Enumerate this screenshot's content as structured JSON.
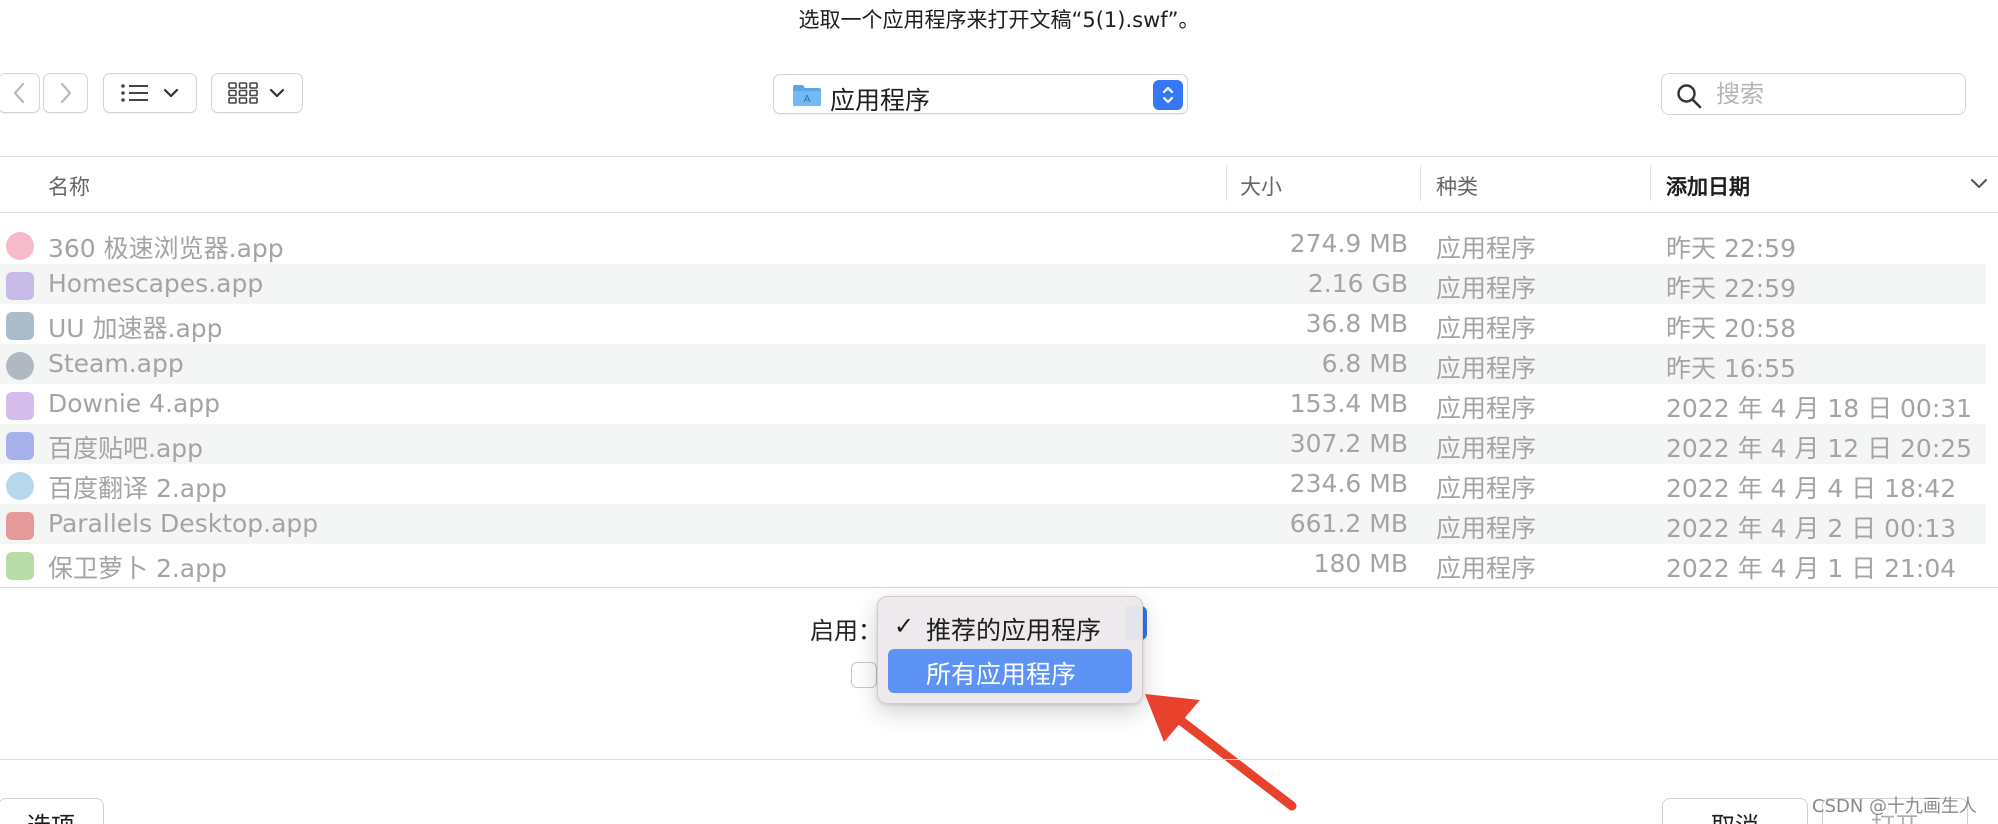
{
  "window_title": "选取一个应用程序来打开文稿“5(1).swf”。",
  "toolbar": {
    "back_icon": "chevron-left-icon",
    "forward_icon": "chevron-right-icon",
    "list_view_icon": "list-icon",
    "grid_view_icon": "grid-icon",
    "location": "应用程序",
    "search_placeholder": "搜索",
    "search_value": ""
  },
  "columns": {
    "name": "名称",
    "size": "大小",
    "kind": "种类",
    "date_added": "添加日期"
  },
  "files": [
    {
      "name": "360 极速浏览器.app",
      "size": "274.9 MB",
      "kind": "应用程序",
      "date": "昨天 22:59",
      "icon": "browser-360-icon",
      "color": "#f4a3b9"
    },
    {
      "name": "Homescapes.app",
      "size": "2.16 GB",
      "kind": "应用程序",
      "date": "昨天 22:59",
      "icon": "homescapes-icon",
      "color": "#b9a6e0"
    },
    {
      "name": "UU 加速器.app",
      "size": "36.8 MB",
      "kind": "应用程序",
      "date": "昨天 20:58",
      "icon": "uu-accelerator-icon",
      "color": "#8fa6b8"
    },
    {
      "name": "Steam.app",
      "size": "6.8 MB",
      "kind": "应用程序",
      "date": "昨天 16:55",
      "icon": "steam-icon",
      "color": "#9aa4b0"
    },
    {
      "name": "Downie 4.app",
      "size": "153.4 MB",
      "kind": "应用程序",
      "date": "2022 年 4 月 18 日 00:31",
      "icon": "downie-icon",
      "color": "#c6a6e6"
    },
    {
      "name": "百度贴吧.app",
      "size": "307.2 MB",
      "kind": "应用程序",
      "date": "2022 年 4 月 12 日 20:25",
      "icon": "baidu-tieba-icon",
      "color": "#8c9ae8"
    },
    {
      "name": "百度翻译 2.app",
      "size": "234.6 MB",
      "kind": "应用程序",
      "date": "2022 年 4 月 4 日 18:42",
      "icon": "baidu-translate-icon",
      "color": "#9ccbe8"
    },
    {
      "name": "Parallels Desktop.app",
      "size": "661.2 MB",
      "kind": "应用程序",
      "date": "2022 年 4 月 2 日 00:13",
      "icon": "parallels-icon",
      "color": "#e07a7a"
    },
    {
      "name": "保卫萝卜 2.app",
      "size": "180 MB",
      "kind": "应用程序",
      "date": "2022 年 4 月 1 日 21:04",
      "icon": "carrot-fantasy-icon",
      "color": "#9fd08a"
    }
  ],
  "enable": {
    "label": "启用：",
    "menu_items": [
      {
        "label": "推荐的应用程序",
        "checked": true
      },
      {
        "label": "所有应用程序",
        "checked": false,
        "highlighted": true
      }
    ]
  },
  "buttons": {
    "options": "选项",
    "cancel": "取消",
    "open": "打开"
  },
  "watermark": "CSDN @十九画生人",
  "colors": {
    "accent": "#3478f6",
    "menu_highlight": "#5c93f5",
    "annotation_arrow": "#e8412c"
  }
}
